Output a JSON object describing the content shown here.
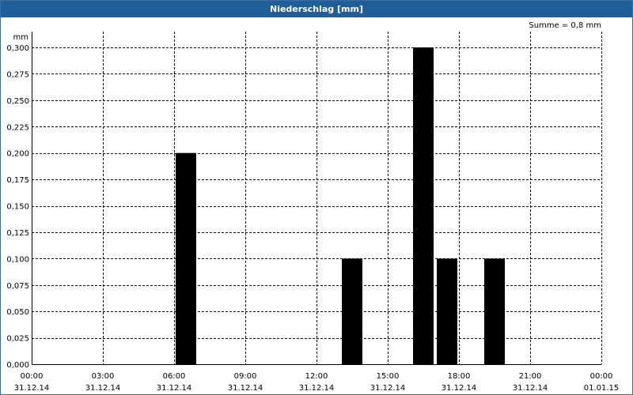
{
  "window": {
    "title": "Niederschlag [mm]"
  },
  "chart_data": {
    "type": "bar",
    "ylabel": "mm",
    "annotation": "Summe = 0,8 mm",
    "ylim": [
      0,
      0.3
    ],
    "yticks": [
      "0,000",
      "0,025",
      "0,050",
      "0,075",
      "0,100",
      "0,125",
      "0,150",
      "0,175",
      "0,200",
      "0,225",
      "0,250",
      "0,275",
      "0,300"
    ],
    "xlim_hours": [
      0,
      24
    ],
    "xticks": [
      {
        "time": "00:00",
        "date": "31.12.14"
      },
      {
        "time": "03:00",
        "date": "31.12.14"
      },
      {
        "time": "06:00",
        "date": "31.12.14"
      },
      {
        "time": "09:00",
        "date": "31.12.14"
      },
      {
        "time": "12:00",
        "date": "31.12.14"
      },
      {
        "time": "15:00",
        "date": "31.12.14"
      },
      {
        "time": "18:00",
        "date": "31.12.14"
      },
      {
        "time": "21:00",
        "date": "31.12.14"
      },
      {
        "time": "00:00",
        "date": "01.01.15"
      }
    ],
    "bars": [
      {
        "start": "06:00",
        "end": "07:00",
        "value": 0.2
      },
      {
        "start": "13:00",
        "end": "14:00",
        "value": 0.1
      },
      {
        "start": "16:00",
        "end": "17:00",
        "value": 0.3
      },
      {
        "start": "17:00",
        "end": "18:00",
        "value": 0.1
      },
      {
        "start": "19:00",
        "end": "20:00",
        "value": 0.1
      }
    ],
    "grid": true,
    "bar_color": "#000000"
  }
}
